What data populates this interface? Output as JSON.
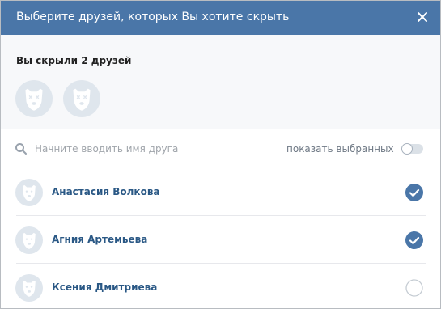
{
  "header": {
    "title": "Выберите друзей, которых Вы хотите скрыть"
  },
  "hidden": {
    "title": "Вы скрыли 2 друзей",
    "avatar_icons": [
      "dog-avatar-icon",
      "dog-avatar-icon"
    ]
  },
  "search": {
    "placeholder": "Начните вводить имя друга",
    "value": "",
    "show_selected_label": "показать выбранных",
    "show_selected_on": false
  },
  "friends": [
    {
      "name": "Анастасия Волкова",
      "selected": true
    },
    {
      "name": "Агния Артемьева",
      "selected": true
    },
    {
      "name": "Ксения Дмитриева",
      "selected": false
    }
  ],
  "colors": {
    "header_bg": "#4a76a8",
    "accent": "#4a76a8",
    "name_link": "#2a5885",
    "avatar_bg": "#dfe6ed",
    "avatar_fg": "#ffffff"
  }
}
